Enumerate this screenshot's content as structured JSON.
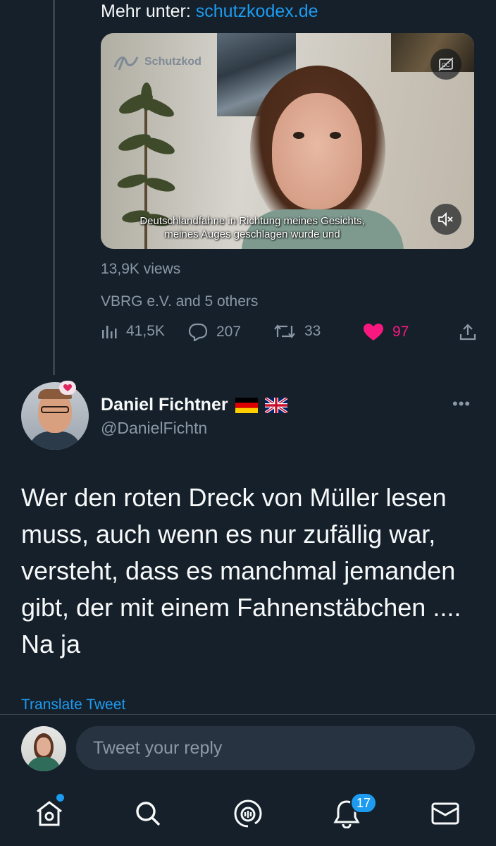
{
  "quoted_tweet": {
    "more_prefix": "Mehr unter: ",
    "more_link": "schutzkodex.de",
    "video": {
      "logo_text": "Schutzkod",
      "subtitle_line1": "Deutschlandfahne in Richtung meines Gesichts,",
      "subtitle_line2": "meines Auges geschlagen wurde und",
      "cc_icon": "closed-captions-off-icon",
      "mute_icon": "muted-speaker-icon"
    },
    "views": "13,9K views",
    "liked_by": "VBRG e.V. and 5 others",
    "actions": {
      "analytics": "41,5K",
      "replies": "207",
      "retweets": "33",
      "likes": "97"
    }
  },
  "reply": {
    "display_name": "Daniel Fichtner",
    "flags": [
      "flag-germany-icon",
      "flag-uk-icon"
    ],
    "handle": "@DanielFichtn",
    "text": "Wer den roten Dreck von Müller lesen muss, auch wenn es nur zufällig war, versteht, dass es manchmal jemanden gibt, der mit einem Fahnenstäbchen .... Na ja",
    "translate_label": "Translate Tweet",
    "more_label": "•••"
  },
  "composer": {
    "placeholder": "Tweet your reply"
  },
  "tabbar": {
    "notifications_count": "17"
  },
  "colors": {
    "background": "#15202b",
    "accent": "#1d9bf0",
    "like": "#f91880",
    "muted_text": "#8b98a5"
  }
}
